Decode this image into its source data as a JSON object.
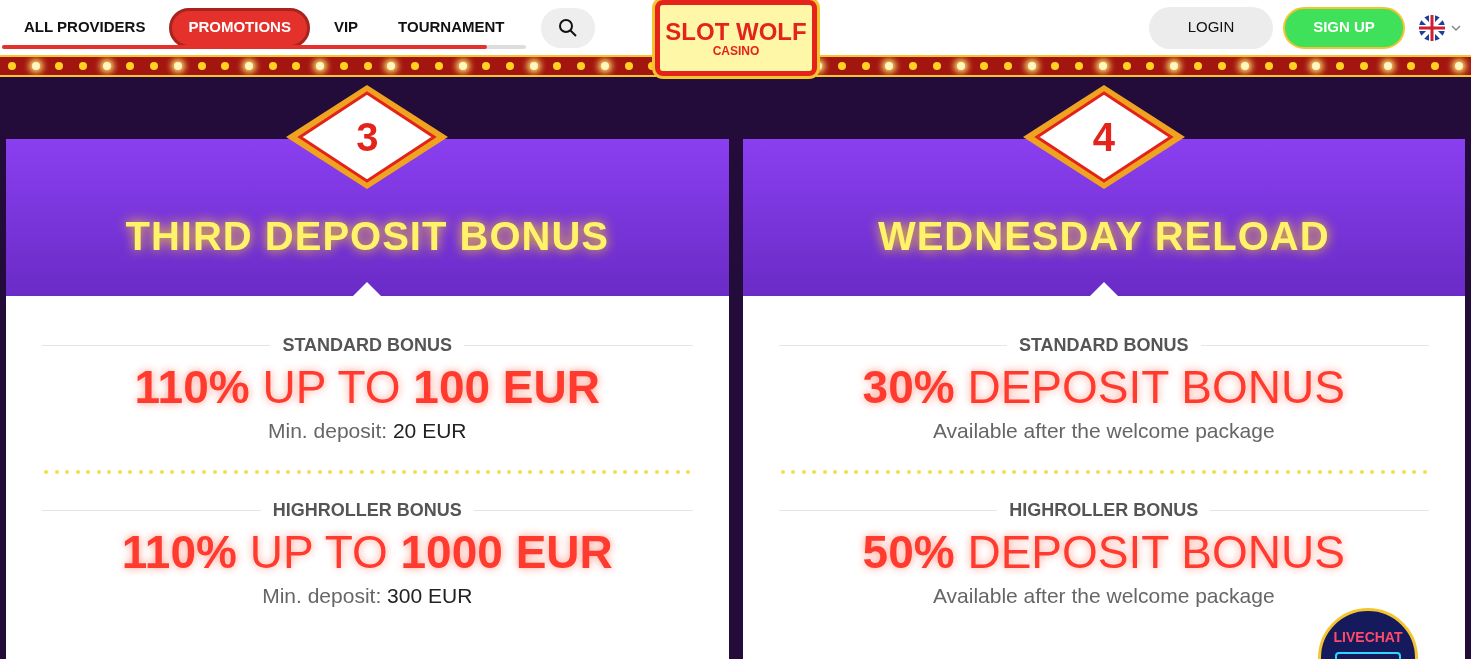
{
  "nav": {
    "items": [
      {
        "label": "ALL PROVIDERS",
        "selected": false
      },
      {
        "label": "PROMOTIONS",
        "selected": true
      },
      {
        "label": "VIP",
        "selected": false
      },
      {
        "label": "TOURNAMENT",
        "selected": false
      }
    ]
  },
  "logo": {
    "name": "SLOT WOLF",
    "sub": "CASINO"
  },
  "auth": {
    "login": "LOGIN",
    "signup": "SIGN UP"
  },
  "cards": [
    {
      "number": "3",
      "title": "THIRD DEPOSIT BONUS",
      "sections": [
        {
          "heading": "STANDARD BONUS",
          "offer": "**110%** UP TO **100 EUR**",
          "note": "Min. deposit: **20 EUR**"
        },
        {
          "heading": "HIGHROLLER BONUS",
          "offer": "**110%** UP TO **1000 EUR**",
          "note": "Min. deposit: **300 EUR**"
        }
      ]
    },
    {
      "number": "4",
      "title": "WEDNESDAY RELOAD",
      "sections": [
        {
          "heading": "STANDARD BONUS",
          "offer": "**30%** DEPOSIT BONUS",
          "note": "Available after the welcome package"
        },
        {
          "heading": "HIGHROLLER BONUS",
          "offer": "**50%** DEPOSIT BONUS",
          "note": "Available after the welcome package"
        }
      ]
    }
  ],
  "livechat": {
    "label": "LIVECHAT"
  }
}
